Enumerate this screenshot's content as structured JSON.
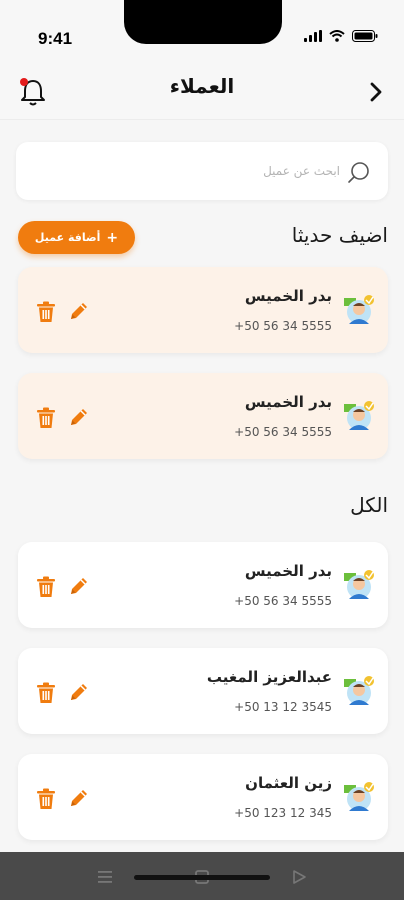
{
  "status_bar": {
    "time": "9:41"
  },
  "header": {
    "title": "العملاء"
  },
  "search": {
    "placeholder": "ابحث عن عميل"
  },
  "recent": {
    "title": "اضيف حديثا",
    "add_label": "أضافة عميل",
    "add_symbol": "+",
    "customers": [
      {
        "name": "بدر الخميس",
        "phone": "+50 56 34 5555"
      },
      {
        "name": "بدر الخميس",
        "phone": "+50 56 34 5555"
      }
    ]
  },
  "all": {
    "title": "الكل",
    "customers": [
      {
        "name": "بدر الخميس",
        "phone": "+50 56 34 5555"
      },
      {
        "name": "عبدالعزيز المغيب",
        "phone": "+50 13 12 3545"
      },
      {
        "name": "زين العثمان",
        "phone": "+50 123 12 345"
      }
    ]
  },
  "colors": {
    "accent": "#f07c0f",
    "recent_card": "#fdf2e8",
    "card": "#ffffff",
    "notification_dot": "#e31b1b"
  },
  "icons": [
    "bell-icon",
    "chevron-right-icon",
    "search-icon",
    "trash-icon",
    "pencil-icon",
    "avatar-icon",
    "menu-icon",
    "square-icon",
    "play-icon"
  ]
}
